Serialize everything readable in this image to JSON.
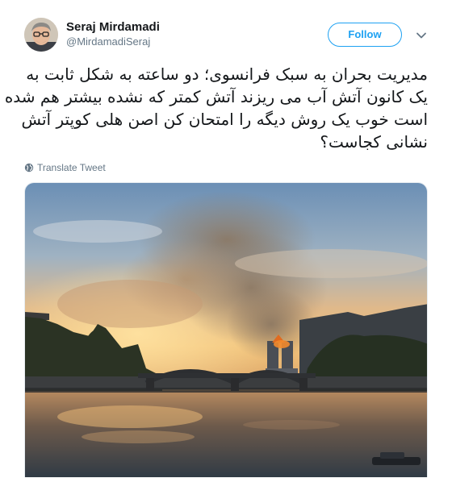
{
  "tweet": {
    "author": {
      "display_name": "Seraj Mirdamadi",
      "handle": "@MirdamadiSeraj",
      "avatar_icon": "avatar-photo"
    },
    "follow_label": "Follow",
    "more_icon": "chevron-down-icon",
    "text_lines": [
      "مدیریت بحران به سبک فرانسوی؛ دو ساعته به شکل ثابت به",
      "یک کانون آتش آب می ریزند آتش کمتر که نشده بیشتر هم شده",
      "است خوب یک روش دیگه را امتحان کن اصن هلی کوپتر آتش",
      "نشانی کجاست؟"
    ],
    "translate_label": "Translate Tweet",
    "translate_icon": "globe-icon",
    "media": {
      "kind": "photo",
      "subject": "notre-dame-fire-river-view"
    }
  },
  "colors": {
    "accent": "#1da1f2",
    "text_primary": "#14171a",
    "text_secondary": "#657786",
    "border": "#e6ecf0"
  }
}
